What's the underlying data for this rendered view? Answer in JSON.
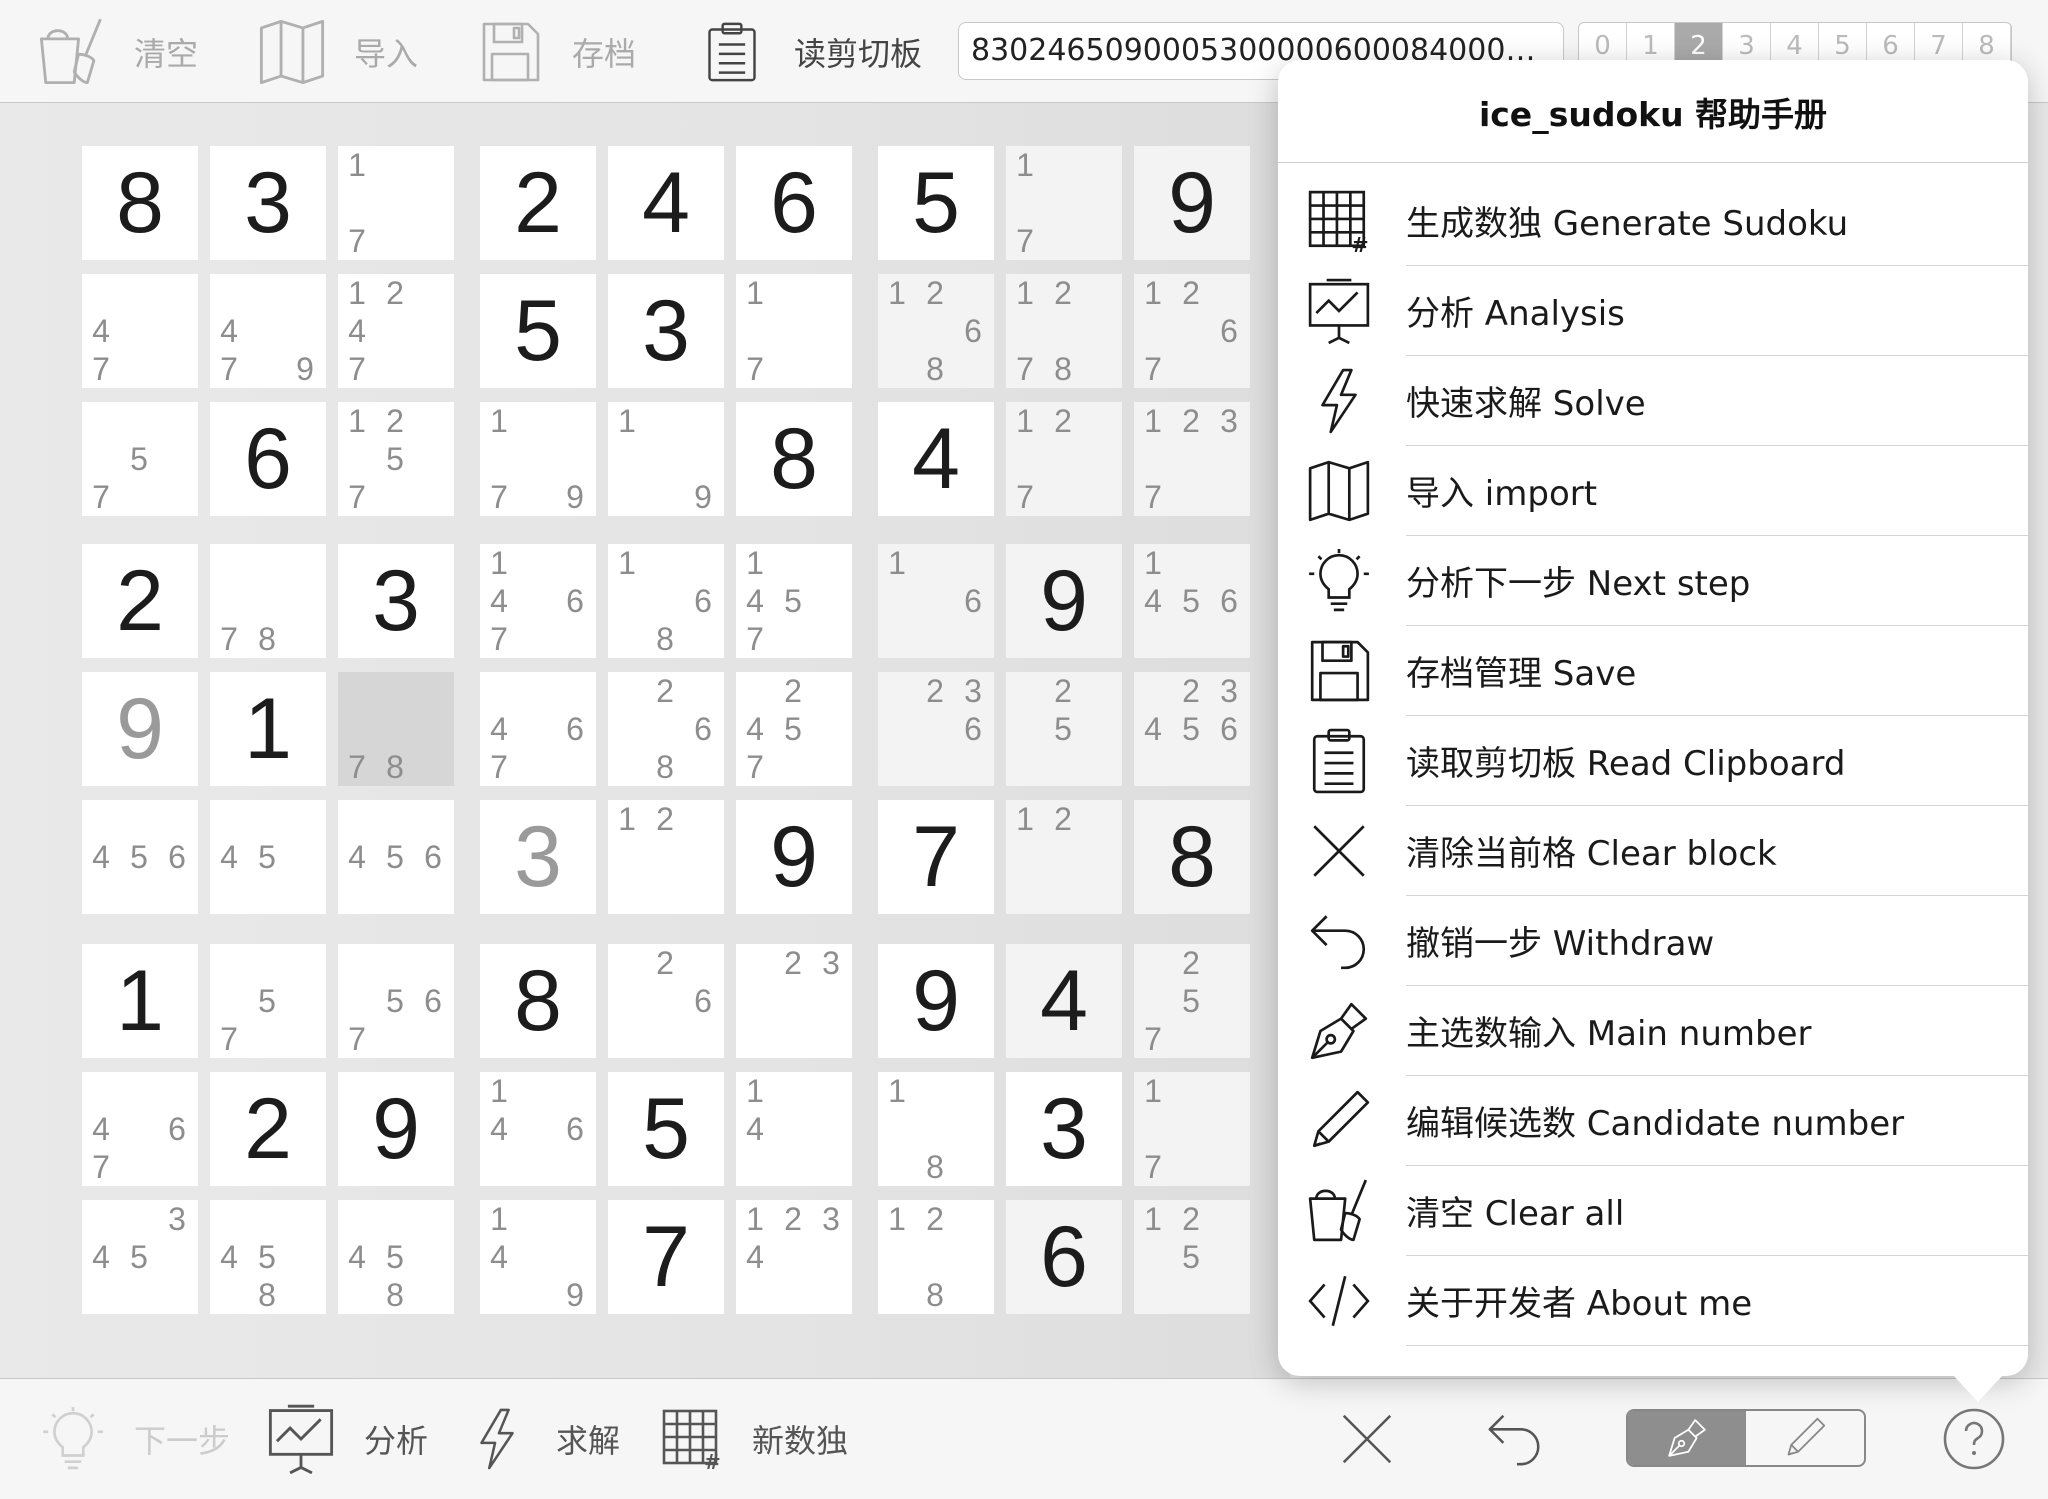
{
  "toolbar": {
    "clear_label": "清空",
    "import_label": "导入",
    "save_label": "存档",
    "clipboard_label": "读剪切板",
    "clipboard_value": "8302465090005300000600084000000000000000000000000",
    "number_segments": [
      "0",
      "1",
      "2",
      "3",
      "4",
      "5",
      "6",
      "7",
      "8"
    ],
    "active_segment": "2"
  },
  "board": {
    "cells": [
      {
        "v": "8",
        "t": "given"
      },
      {
        "v": "3",
        "t": "given"
      },
      {
        "c": [
          "1",
          "7"
        ]
      },
      {
        "v": "2",
        "t": "given"
      },
      {
        "v": "4",
        "t": "given"
      },
      {
        "v": "6",
        "t": "given"
      },
      {
        "v": "5",
        "t": "given"
      },
      {
        "c": [
          "1",
          "7"
        ]
      },
      {
        "v": "9",
        "t": "given"
      },
      {
        "c": [
          "4",
          "7"
        ]
      },
      {
        "c": [
          "4",
          "7",
          "9"
        ]
      },
      {
        "c": [
          "1",
          "2",
          "4",
          "7"
        ]
      },
      {
        "v": "5",
        "t": "given"
      },
      {
        "v": "3",
        "t": "given"
      },
      {
        "c": [
          "1",
          "7"
        ]
      },
      {
        "c": [
          "1",
          "2",
          "6",
          "8"
        ]
      },
      {
        "c": [
          "1",
          "2",
          "7",
          "8"
        ]
      },
      {
        "c": [
          "1",
          "2",
          "6",
          "7"
        ]
      },
      {
        "c": [
          "5",
          "7"
        ]
      },
      {
        "v": "6",
        "t": "given"
      },
      {
        "c": [
          "1",
          "2",
          "5",
          "7"
        ]
      },
      {
        "c": [
          "1",
          "7",
          "9"
        ]
      },
      {
        "c": [
          "1",
          "9"
        ]
      },
      {
        "v": "8",
        "t": "given"
      },
      {
        "v": "4",
        "t": "given"
      },
      {
        "c": [
          "1",
          "2",
          "7"
        ]
      },
      {
        "c": [
          "1",
          "2",
          "3",
          "7"
        ]
      },
      {
        "v": "2",
        "t": "given"
      },
      {
        "c": [
          "7",
          "8"
        ]
      },
      {
        "v": "3",
        "t": "given"
      },
      {
        "c": [
          "1",
          "4",
          "6",
          "7"
        ]
      },
      {
        "c": [
          "1",
          "6",
          "8"
        ]
      },
      {
        "c": [
          "1",
          "4",
          "5",
          "7"
        ]
      },
      {
        "c": [
          "1",
          "6"
        ]
      },
      {
        "v": "9",
        "t": "given"
      },
      {
        "c": [
          "1",
          "4",
          "5",
          "6"
        ]
      },
      {
        "v": "9",
        "t": "user"
      },
      {
        "v": "1",
        "t": "given"
      },
      {
        "c": [
          "7",
          "8"
        ],
        "sel": true
      },
      {
        "c": [
          "4",
          "6",
          "7"
        ]
      },
      {
        "c": [
          "2",
          "6",
          "8"
        ]
      },
      {
        "c": [
          "2",
          "4",
          "5",
          "7"
        ]
      },
      {
        "c": [
          "2",
          "3",
          "6"
        ]
      },
      {
        "c": [
          "2",
          "5"
        ]
      },
      {
        "c": [
          "2",
          "3",
          "4",
          "5",
          "6"
        ]
      },
      {
        "c": [
          "4",
          "5",
          "6"
        ]
      },
      {
        "c": [
          "4",
          "5"
        ]
      },
      {
        "c": [
          "4",
          "5",
          "6"
        ]
      },
      {
        "v": "3",
        "t": "user"
      },
      {
        "c": [
          "1",
          "2"
        ]
      },
      {
        "v": "9",
        "t": "given"
      },
      {
        "v": "7",
        "t": "given"
      },
      {
        "c": [
          "1",
          "2"
        ]
      },
      {
        "v": "8",
        "t": "given"
      },
      {
        "v": "1",
        "t": "given"
      },
      {
        "c": [
          "5",
          "7"
        ]
      },
      {
        "c": [
          "5",
          "6",
          "7"
        ]
      },
      {
        "v": "8",
        "t": "given"
      },
      {
        "c": [
          "2",
          "6"
        ]
      },
      {
        "c": [
          "2",
          "3"
        ]
      },
      {
        "v": "9",
        "t": "given"
      },
      {
        "v": "4",
        "t": "given"
      },
      {
        "c": [
          "2",
          "5",
          "7"
        ]
      },
      {
        "c": [
          "4",
          "6",
          "7"
        ]
      },
      {
        "v": "2",
        "t": "given"
      },
      {
        "v": "9",
        "t": "given"
      },
      {
        "c": [
          "1",
          "4",
          "6"
        ]
      },
      {
        "v": "5",
        "t": "given"
      },
      {
        "c": [
          "1",
          "4"
        ]
      },
      {
        "c": [
          "1",
          "8"
        ]
      },
      {
        "v": "3",
        "t": "given"
      },
      {
        "c": [
          "1",
          "7"
        ]
      },
      {
        "c": [
          "3",
          "4",
          "5"
        ]
      },
      {
        "c": [
          "4",
          "5",
          "8"
        ]
      },
      {
        "c": [
          "4",
          "5",
          "8"
        ]
      },
      {
        "c": [
          "1",
          "4",
          "9"
        ]
      },
      {
        "v": "7",
        "t": "given"
      },
      {
        "c": [
          "1",
          "2",
          "3",
          "4"
        ]
      },
      {
        "c": [
          "1",
          "2",
          "8"
        ]
      },
      {
        "v": "6",
        "t": "given"
      },
      {
        "c": [
          "1",
          "2",
          "5"
        ]
      }
    ]
  },
  "help": {
    "title": "ice_sudoku 帮助手册",
    "items": [
      {
        "icon": "grid-hash-icon",
        "label": "生成数独 Generate Sudoku"
      },
      {
        "icon": "chart-board-icon",
        "label": "分析 Analysis"
      },
      {
        "icon": "lightning-icon",
        "label": "快速求解 Solve"
      },
      {
        "icon": "map-icon",
        "label": "导入 import"
      },
      {
        "icon": "lightbulb-icon",
        "label": "分析下一步 Next step"
      },
      {
        "icon": "floppy-icon",
        "label": "存档管理 Save"
      },
      {
        "icon": "clipboard-icon",
        "label": "读取剪切板 Read Clipboard"
      },
      {
        "icon": "close-icon",
        "label": "清除当前格 Clear block"
      },
      {
        "icon": "undo-icon",
        "label": "撤销一步 Withdraw"
      },
      {
        "icon": "pen-icon",
        "label": "主选数输入 Main number"
      },
      {
        "icon": "pencil-icon",
        "label": "编辑候选数 Candidate number"
      },
      {
        "icon": "broom-bucket-icon",
        "label": "清空 Clear all"
      },
      {
        "icon": "code-icon",
        "label": "关于开发者 About me"
      }
    ]
  },
  "bottom": {
    "next_label": "下一步",
    "analysis_label": "分析",
    "solve_label": "求解",
    "new_label": "新数独",
    "active_mode": "main"
  }
}
